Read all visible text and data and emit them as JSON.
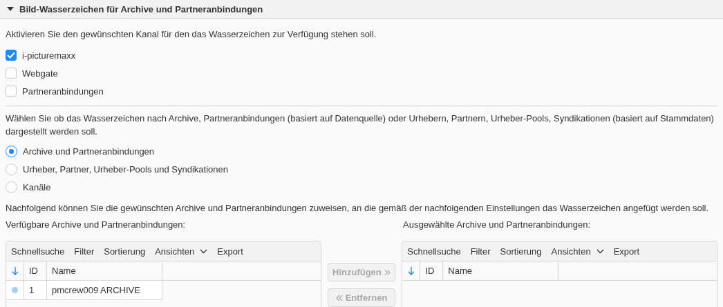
{
  "section": {
    "title": "Bild-Wasserzeichen für Archive und Partneranbindungen",
    "expanded": true
  },
  "channel_intro": "Aktivieren Sie den gewünschten Kanal für den das Wasserzeichen zur Verfügung stehen soll.",
  "channels": [
    {
      "label": "i-picturemaxx",
      "checked": true
    },
    {
      "label": "Webgate",
      "checked": false
    },
    {
      "label": "Partneranbindungen",
      "checked": false
    }
  ],
  "mode_intro": "Wählen Sie ob das Wasserzeichen nach Archive, Partneranbindungen (basiert auf Datenquelle) oder Urhebern, Partnern, Urheber-Pools, Syndikationen (basiert auf Stammdaten) dargestellt werden soll.",
  "modes": [
    {
      "label": "Archive und Partneranbindungen",
      "selected": true
    },
    {
      "label": "Urheber, Partner, Urheber-Pools und Syndikationen",
      "selected": false
    },
    {
      "label": "Kanäle",
      "selected": false
    }
  ],
  "assign_intro": "Nachfolgend können Sie die gewünschten Archive und Partneranbindungen zuweisen, an die gemäß der nachfolgenden Einstellungen das Wasserzeichen angefügt werden soll.",
  "available": {
    "label": "Verfügbare Archive und Partneranbindungen:",
    "toolbar": [
      "Schnellsuche",
      "Filter",
      "Sortierung",
      "Ansichten",
      "Export"
    ],
    "columns": [
      "ID",
      "Name"
    ],
    "rows": [
      {
        "id": "1",
        "name": "pmcrew009 ARCHIVE",
        "color": "#a6cdf5"
      }
    ]
  },
  "buttons": [
    {
      "label": "Hinzufügen",
      "kind": "add",
      "disabled": true
    },
    {
      "label": "Entfernen",
      "kind": "remove",
      "disabled": true
    }
  ],
  "selected": {
    "label": "Ausgewählte Archive und Partneranbindungen:",
    "toolbar": [
      "Schnellsuche",
      "Filter",
      "Sortierung",
      "Ansichten",
      "Export"
    ],
    "columns": [
      "ID",
      "Name"
    ]
  }
}
